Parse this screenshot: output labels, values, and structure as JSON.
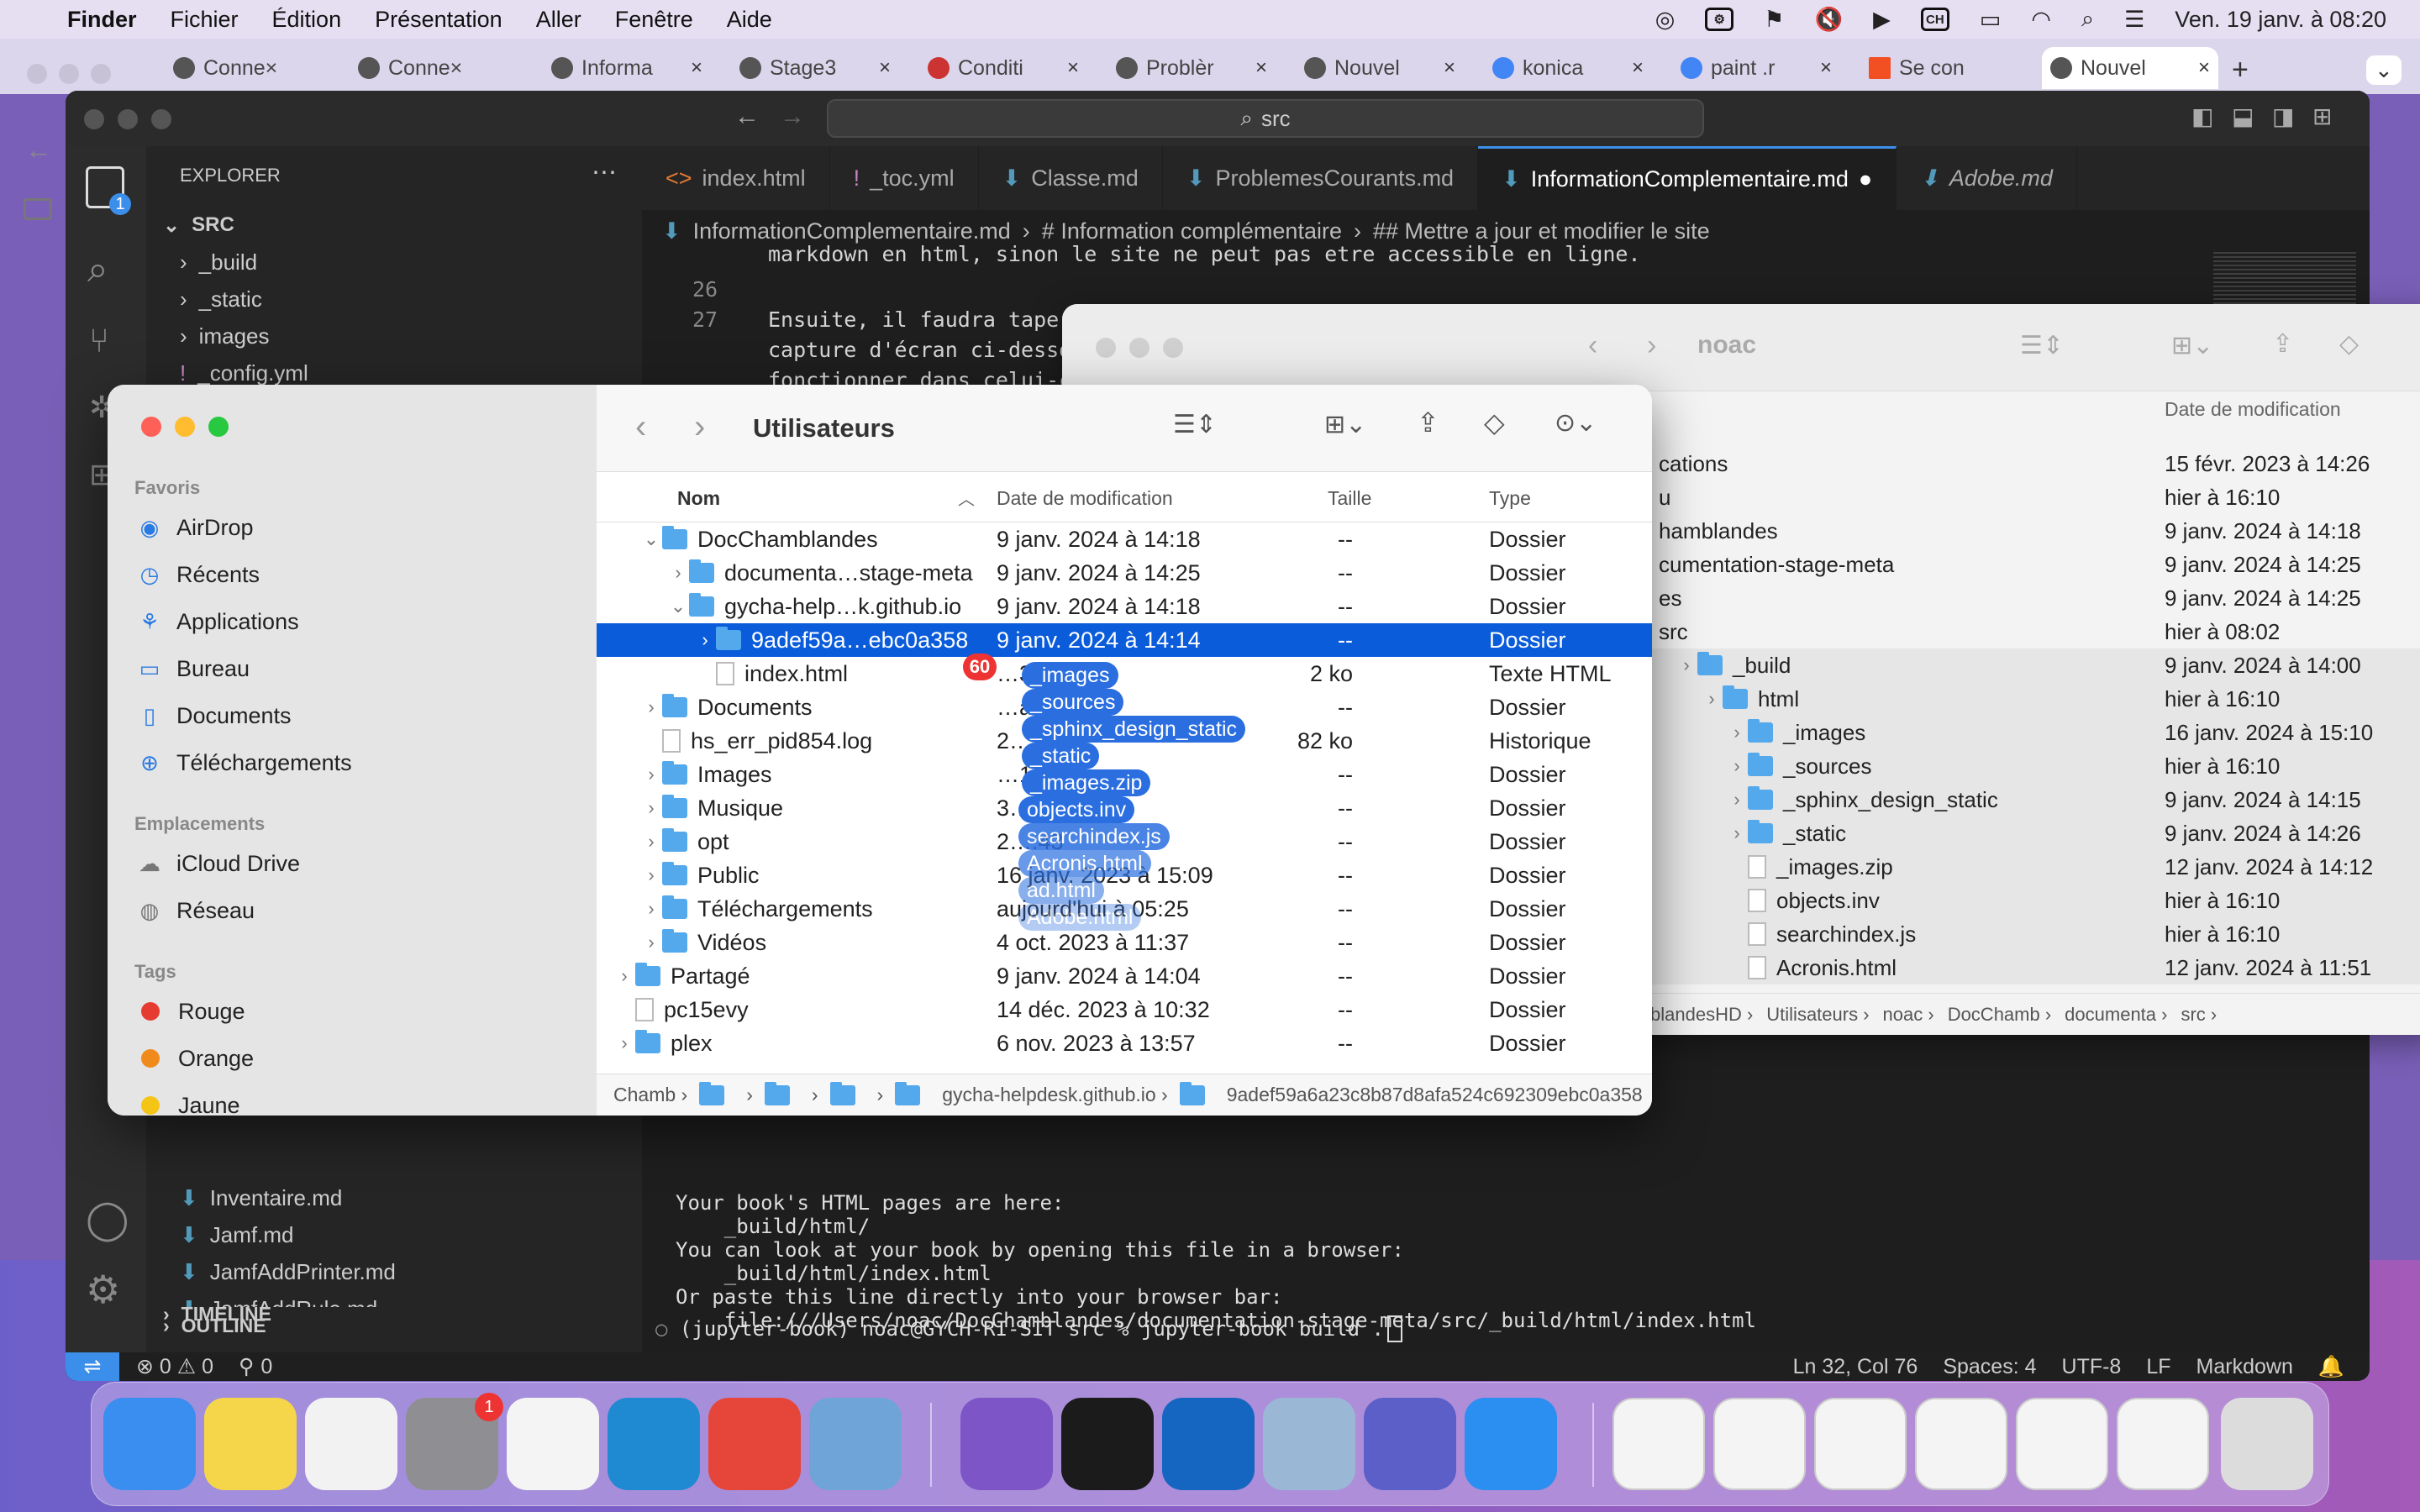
{
  "menubar": {
    "apple": "",
    "app": "Finder",
    "items": [
      "Fichier",
      "Édition",
      "Présentation",
      "Aller",
      "Fenêtre",
      "Aide"
    ],
    "clock": "Ven. 19 janv. à  08:20"
  },
  "chrome_tabs": [
    "Conne×",
    "Conne×",
    "Informa",
    "Stage3",
    "Conditi",
    "Problèr",
    "Nouvel",
    "konica",
    "paint .r",
    "Se con",
    "Nouvel"
  ],
  "vscode": {
    "search": "src",
    "explorer_title": "EXPLORER",
    "root": "SRC",
    "tree": [
      "_build",
      "_static",
      "images",
      "_config.yml"
    ],
    "tree_bottom": [
      "Inventaire.md",
      "Jamf.md",
      "JamfAddPrinter.md",
      "JamfAddRule.md"
    ],
    "outline": "OUTLINE",
    "timeline": "TIMELINE",
    "tabs": [
      "index.html",
      "_toc.yml",
      "Classe.md",
      "ProblemesCourants.md",
      "InformationComplementaire.md",
      "Adobe.md"
    ],
    "breadcrumb": [
      "InformationComplementaire.md",
      "# Information complémentaire",
      "## Mettre a jour et modifier le site"
    ],
    "code_lines": [
      {
        "num": "",
        "text": "markdown en html, sinon le site ne peut pas etre accessible en ligne."
      },
      {
        "num": "26",
        "text": ""
      },
      {
        "num": "27",
        "text": "Ensuite, il faudra taper la commande conda activate jupyter-book (dans un terminal visual studio code, comme sur la"
      },
      {
        "num": "",
        "text": "capture d'écran ci-dessous:) c"
      },
      {
        "num": "",
        "text": "fonctionner dans celui-ci."
      }
    ],
    "terminal_lines": [
      "Your book's HTML pages are here:",
      "    _build/html/",
      "You can look at your book by opening this file in a browser:",
      "    _build/html/index.html",
      "Or paste this line directly into your browser bar:",
      "    file:///Users/noac/DocChamblandes/documentation-stage-meta/src/_build/html/index.html",
      "",
      "===============================================================================",
      "",
      "(jupyter-book) noac@GYCH-RI-SIT src % jupyter-book build ."
    ],
    "status": {
      "errors": "⊗ 0 ⚠ 0",
      "ports": "0",
      "position": "Ln 32, Col 76",
      "spaces": "Spaces: 4",
      "encoding": "UTF-8",
      "eol": "LF",
      "language": "Markdown"
    },
    "activity_badge": "1"
  },
  "finder_back": {
    "title": "noac",
    "col_date": "Date de modification",
    "rows": [
      {
        "name": "cations",
        "date": "15 févr. 2023 à 14:26",
        "indent": 0,
        "kind": "text"
      },
      {
        "name": "u",
        "date": "hier à 16:10",
        "indent": 0,
        "kind": "text"
      },
      {
        "name": "hamblandes",
        "date": "9 janv. 2024 à 14:18",
        "indent": 0,
        "kind": "text"
      },
      {
        "name": "cumentation-stage-meta",
        "date": "9 janv. 2024 à 14:25",
        "indent": 0,
        "kind": "text"
      },
      {
        "name": "es",
        "date": "9 janv. 2024 à 14:25",
        "indent": 0,
        "kind": "text"
      },
      {
        "name": "src",
        "date": "hier à 08:02",
        "indent": 0,
        "kind": "text"
      },
      {
        "name": "_build",
        "date": "9 janv. 2024 à 14:00",
        "indent": 1,
        "kind": "folder"
      },
      {
        "name": "html",
        "date": "hier à 16:10",
        "indent": 2,
        "kind": "folder"
      },
      {
        "name": "_images",
        "date": "16 janv. 2024 à 15:10",
        "indent": 3,
        "kind": "folder"
      },
      {
        "name": "_sources",
        "date": "hier à 16:10",
        "indent": 3,
        "kind": "folder"
      },
      {
        "name": "_sphinx_design_static",
        "date": "9 janv. 2024 à 14:15",
        "indent": 3,
        "kind": "folder"
      },
      {
        "name": "_static",
        "date": "9 janv. 2024 à 14:26",
        "indent": 3,
        "kind": "folder"
      },
      {
        "name": "_images.zip",
        "date": "12 janv. 2024 à 14:12",
        "indent": 3,
        "kind": "doc"
      },
      {
        "name": "objects.inv",
        "date": "hier à 16:10",
        "indent": 3,
        "kind": "doc"
      },
      {
        "name": "searchindex.js",
        "date": "hier à 16:10",
        "indent": 3,
        "kind": "doc"
      },
      {
        "name": "Acronis.html",
        "date": "12 janv. 2024 à 11:51",
        "indent": 3,
        "kind": "doc"
      }
    ],
    "path": [
      "blandesHD ›",
      "Utilisateurs ›",
      "noac ›",
      "DocChamb ›",
      "documenta ›",
      "src ›"
    ]
  },
  "finder": {
    "title": "Utilisateurs",
    "sidebar": {
      "favorites_label": "Favoris",
      "favorites": [
        {
          "label": "AirDrop",
          "icon": "airdrop-icon"
        },
        {
          "label": "Récents",
          "icon": "clock-icon"
        },
        {
          "label": "Applications",
          "icon": "applications-icon"
        },
        {
          "label": "Bureau",
          "icon": "desktop-icon"
        },
        {
          "label": "Documents",
          "icon": "document-icon"
        },
        {
          "label": "Téléchargements",
          "icon": "download-icon"
        }
      ],
      "locations_label": "Emplacements",
      "locations": [
        {
          "label": "iCloud Drive",
          "icon": "cloud-icon"
        },
        {
          "label": "Réseau",
          "icon": "globe-icon"
        }
      ],
      "tags_label": "Tags",
      "tags": [
        {
          "label": "Rouge",
          "color": "#e63b30"
        },
        {
          "label": "Orange",
          "color": "#f08a1c"
        },
        {
          "label": "Jaune",
          "color": "#f4c417"
        }
      ]
    },
    "columns": {
      "name": "Nom",
      "date": "Date de modification",
      "size": "Taille",
      "kind": "Type"
    },
    "rows": [
      {
        "indent": 1,
        "chev": "⌄",
        "icon": "folder",
        "name": "DocChamblandes",
        "date": "9 janv. 2024 à 14:18",
        "size": "--",
        "kind": "Dossier",
        "sel": false
      },
      {
        "indent": 2,
        "chev": "›",
        "icon": "folder",
        "name": "documenta…stage-meta",
        "date": "9 janv. 2024 à 14:25",
        "size": "--",
        "kind": "Dossier",
        "sel": false
      },
      {
        "indent": 2,
        "chev": "⌄",
        "icon": "folder",
        "name": "gycha-help…k.github.io",
        "date": "9 janv. 2024 à 14:18",
        "size": "--",
        "kind": "Dossier",
        "sel": false
      },
      {
        "indent": 3,
        "chev": "›",
        "icon": "folder",
        "name": "9adef59a…ebc0a358",
        "date": "9 janv. 2024 à 14:14",
        "size": "--",
        "kind": "Dossier",
        "sel": true
      },
      {
        "indent": 3,
        "chev": "",
        "icon": "doc",
        "name": "index.html",
        "date": "…3 à 15:29",
        "size": "2 ko",
        "kind": "Texte HTML",
        "sel": false
      },
      {
        "indent": 1,
        "chev": "›",
        "icon": "folder",
        "name": "Documents",
        "date": "…à 15:34",
        "size": "--",
        "kind": "Dossier",
        "sel": false
      },
      {
        "indent": 1,
        "chev": "",
        "icon": "doc",
        "name": "hs_err_pid854.log",
        "date": "2…",
        "size": "82 ko",
        "kind": "Historique",
        "sel": false
      },
      {
        "indent": 1,
        "chev": "›",
        "icon": "folder",
        "name": "Images",
        "date": "…1:15",
        "size": "--",
        "kind": "Dossier",
        "sel": false
      },
      {
        "indent": 1,
        "chev": "›",
        "icon": "folder",
        "name": "Musique",
        "date": "3… 08:47",
        "size": "--",
        "kind": "Dossier",
        "sel": false
      },
      {
        "indent": 1,
        "chev": "›",
        "icon": "folder",
        "name": "opt",
        "date": "2…:43",
        "size": "--",
        "kind": "Dossier",
        "sel": false
      },
      {
        "indent": 1,
        "chev": "›",
        "icon": "folder",
        "name": "Public",
        "date": "16 janv. 2023 à 15:09",
        "size": "--",
        "kind": "Dossier",
        "sel": false
      },
      {
        "indent": 1,
        "chev": "›",
        "icon": "folder",
        "name": "Téléchargements",
        "date": "aujourd'hui à 05:25",
        "size": "--",
        "kind": "Dossier",
        "sel": false
      },
      {
        "indent": 1,
        "chev": "›",
        "icon": "folder",
        "name": "Vidéos",
        "date": "4 oct. 2023 à 11:37",
        "size": "--",
        "kind": "Dossier",
        "sel": false
      },
      {
        "indent": 0,
        "chev": "›",
        "icon": "folder",
        "name": "Partagé",
        "date": "9 janv. 2024 à 14:04",
        "size": "--",
        "kind": "Dossier",
        "sel": false
      },
      {
        "indent": 0,
        "chev": "",
        "icon": "doc",
        "name": "pc15evy",
        "date": "14 déc. 2023 à 10:32",
        "size": "--",
        "kind": "Dossier",
        "sel": false
      },
      {
        "indent": 0,
        "chev": "›",
        "icon": "folder",
        "name": "plex",
        "date": "6 nov. 2023 à 13:57",
        "size": "--",
        "kind": "Dossier",
        "sel": false
      }
    ],
    "path": [
      "Chamb ›",
      "›",
      "›",
      "›",
      "gycha-helpdesk.github.io ›",
      "9adef59a6a23c8b87d8afa524c692309ebc0a358"
    ],
    "drag_count": "60",
    "drag_items": [
      "_images",
      "_sources",
      "_sphinx_design_static",
      "_static",
      "_images.zip",
      "objects.inv",
      "searchindex.js",
      "Acronis.html",
      "ad.html",
      "Adobe.html"
    ]
  },
  "dock": {
    "items": [
      {
        "name": "finder",
        "color": "#3a8ef0"
      },
      {
        "name": "notes",
        "color": "#f5d64a"
      },
      {
        "name": "photos",
        "color": "#f2f2f2"
      },
      {
        "name": "settings",
        "color": "#8e8e93"
      },
      {
        "name": "chrome",
        "color": "#f4f4f4"
      },
      {
        "name": "vscode",
        "color": "#1f8ad2"
      },
      {
        "name": "anydesk",
        "color": "#e6463a"
      },
      {
        "name": "preview",
        "color": "#6fa4d8"
      },
      {
        "name": "github",
        "color": "#7d55c7"
      },
      {
        "name": "terminal",
        "color": "#1b1b1b"
      },
      {
        "name": "outlook",
        "color": "#1566c0"
      },
      {
        "name": "preview-2",
        "color": "#9ab8d6"
      },
      {
        "name": "teams",
        "color": "#5b5fc7"
      },
      {
        "name": "safari",
        "color": "#2a8ff0"
      }
    ],
    "settings_badge": "1"
  }
}
